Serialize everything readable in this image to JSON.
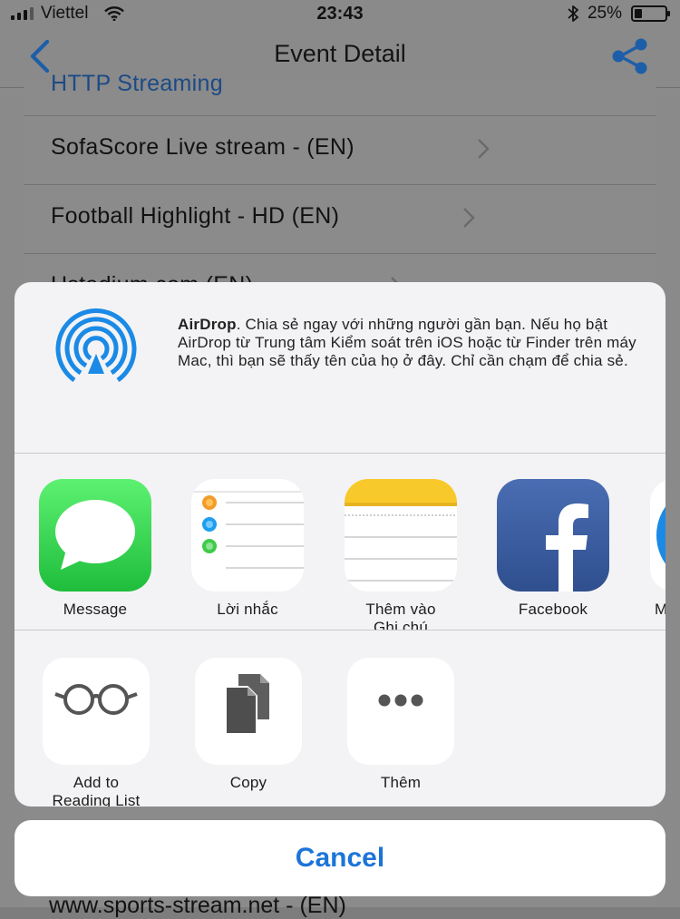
{
  "status_bar": {
    "carrier": "Viettel",
    "time": "23:43",
    "battery_percent_label": "25%",
    "battery_level": 0.25
  },
  "nav": {
    "title": "Event Detail"
  },
  "list": {
    "partial_top": "HTTP Streaming",
    "rows": [
      "SofaScore Live stream -  (EN)",
      "Football Highlight - HD (EN)",
      "Ustadium.com (EN)"
    ],
    "partial_bottom": "www.sports-stream.net -  (EN)"
  },
  "share_sheet": {
    "airdrop": {
      "title": "AirDrop",
      "description": ". Chia sẻ ngay với những người gần bạn. Nếu họ bật AirDrop từ Trung tâm Kiểm soát trên iOS hoặc từ Finder trên máy Mac, thì bạn sẽ thấy tên của họ ở đây. Chỉ cần chạm để chia sẻ."
    },
    "apps": [
      {
        "label": "Message",
        "icon": "messages-icon"
      },
      {
        "label": "Lời nhắc",
        "icon": "reminders-icon"
      },
      {
        "label": "Thêm vào\nGhi chú",
        "icon": "notes-icon"
      },
      {
        "label": "Facebook",
        "icon": "facebook-icon"
      },
      {
        "label": "M",
        "icon": "messenger-icon"
      }
    ],
    "actions": [
      {
        "label": "Add to\nReading List",
        "icon": "glasses-icon"
      },
      {
        "label": "Copy",
        "icon": "copy-icon"
      },
      {
        "label": "Thêm",
        "icon": "more-icon"
      }
    ],
    "cancel_label": "Cancel"
  },
  "colors": {
    "accent": "#1d74d8",
    "airdrop_blue": "#1a8ae6",
    "messages_green": "#34c759",
    "facebook_blue": "#3b5998",
    "notes_yellow": "#f8c92a"
  }
}
